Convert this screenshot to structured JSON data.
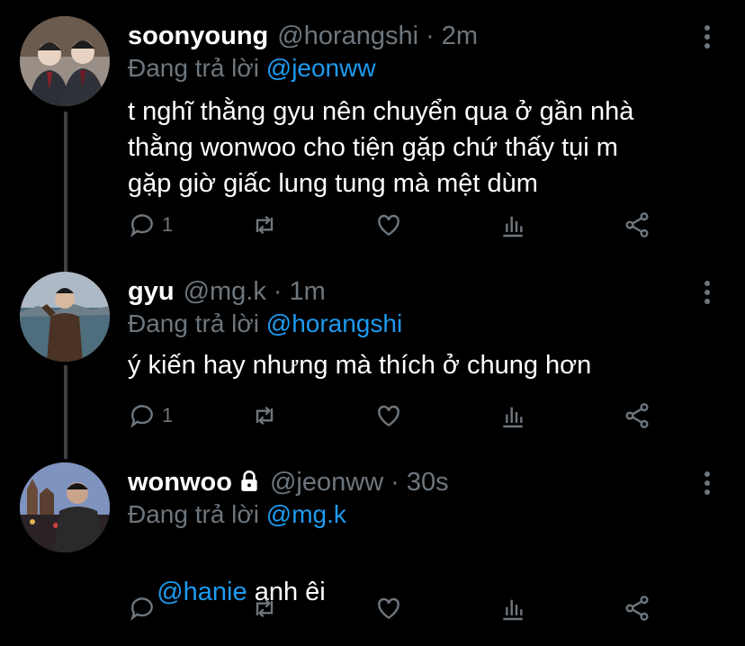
{
  "tweets": [
    {
      "name": "soonyoung",
      "handle": "@horangshi",
      "time": "2m",
      "replying_prefix": "Đang trả lời ",
      "replying_to": "@jeonww",
      "text": "t nghĩ thằng gyu nên chuyển qua ở gần nhà\nthằng wonwoo cho tiện gặp chứ thấy tụi m\ngặp giờ giấc lung tung mà mệt dùm",
      "reply_count": "1",
      "locked": false
    },
    {
      "name": "gyu",
      "handle": "@mg.k",
      "time": "1m",
      "replying_prefix": "Đang trả lời ",
      "replying_to": "@horangshi",
      "text": "ý kiến hay nhưng mà thích ở chung hơn",
      "reply_count": "1",
      "locked": false
    },
    {
      "name": "wonwoo",
      "handle": "@jeonww",
      "time": "30s",
      "replying_prefix": "Đang trả lời ",
      "replying_to": "@mg.k",
      "text_mention": "@hanie",
      "text_rest": " anh êi",
      "reply_count": "",
      "locked": true
    }
  ],
  "separator": "·",
  "icons": [
    "reply-icon",
    "retweet-icon",
    "like-icon",
    "analytics-icon",
    "share-icon",
    "more-icon",
    "lock-icon"
  ],
  "colors": {
    "background": "#000000",
    "secondary_text": "#6e767d",
    "link": "#1d9bf0"
  }
}
